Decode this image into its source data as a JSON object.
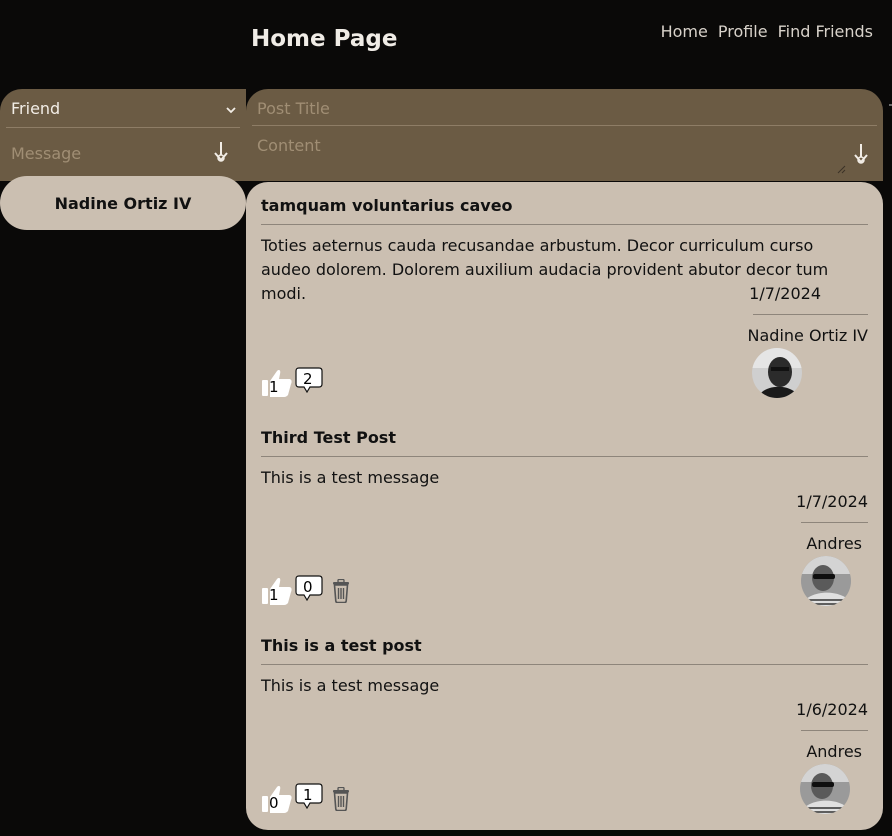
{
  "header": {
    "title": "Home Page",
    "nav": [
      "Home",
      "Profile",
      "Find Friends"
    ]
  },
  "message_form": {
    "friend_select_value": "Friend",
    "message_placeholder": "Message",
    "send_icon": "send-arrow-icon"
  },
  "friends": [
    {
      "name": "Nadine Ortiz IV"
    }
  ],
  "post_form": {
    "title_placeholder": "Post Title",
    "content_placeholder": "Content",
    "submit_icon": "send-arrow-icon"
  },
  "posts": [
    {
      "title": "tamquam voluntarius caveo",
      "content": "Toties aeternus cauda recusandae arbustum. Decor curriculum curso audeo dolorem. Dolorem auxilium audacia provident abutor decor tum modi.",
      "date": "1/7/2024",
      "author": "Nadine Ortiz IV",
      "likes": "1",
      "comments": "2",
      "deletable": false
    },
    {
      "title": "Third Test Post",
      "content": "This is a test message",
      "date": "1/7/2024",
      "author": "Andres",
      "likes": "1",
      "comments": "0",
      "deletable": true
    },
    {
      "title": "This is a test post",
      "content": "This is a test message",
      "date": "1/6/2024",
      "author": "Andres",
      "likes": "0",
      "comments": "1",
      "deletable": true
    }
  ],
  "colors": {
    "background": "#0a0908",
    "form_brown": "#6b5b44",
    "card_beige": "#cbbfb1"
  }
}
